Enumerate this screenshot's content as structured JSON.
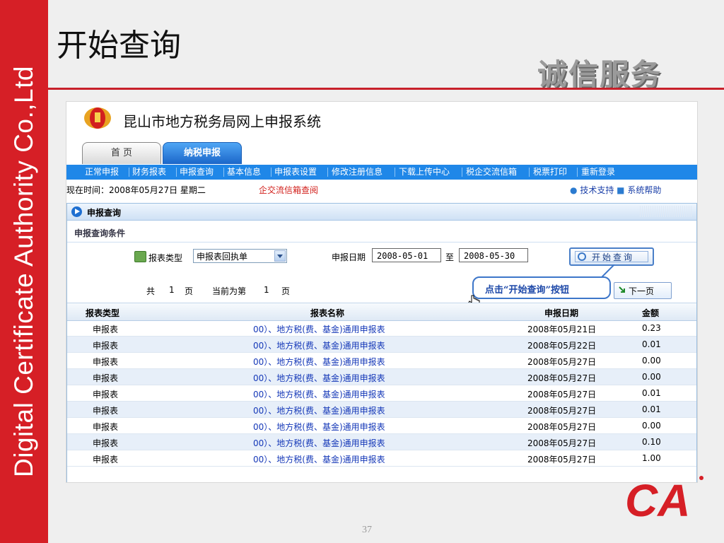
{
  "slide": {
    "sidebar_text": "Digital Certificate Authority Co.,Ltd",
    "title": "开始查询",
    "slogan": "诚信服务",
    "page_number": "37",
    "logo_text": "CA"
  },
  "app": {
    "title": "昆山市地方税务局网上申报系统",
    "tabs": [
      {
        "label": "首 页",
        "active": false
      },
      {
        "label": "纳税申报",
        "active": true
      }
    ],
    "nav": [
      "正常申报",
      "财务报表",
      "申报查询",
      "基本信息",
      "申报表设置",
      "修改注册信息",
      "下载上传中心",
      "税企交流信箱",
      "税票打印",
      "重新登录"
    ],
    "current_time": "现在时间：2008年05月27日 星期二",
    "mailbox_link": "企交流信箱查阅",
    "tech_support": "技术支持",
    "help": "系统帮助"
  },
  "panel": {
    "title": "申报查询",
    "section_label": "申报查询条件",
    "form": {
      "report_type_label": "报表类型",
      "report_type_value": "申报表回执单",
      "date_label": "申报日期",
      "date_from": "2008-05-01",
      "date_sep": "至",
      "date_to": "2008-05-30",
      "search_button": "开始查询"
    },
    "pager": {
      "total_label": "共",
      "total_pages": "1",
      "page_unit": "页",
      "current_label": "当前为第",
      "current_page": "1",
      "current_unit": "页",
      "next_button": "下一页"
    },
    "callout": "点击“开始查询”按钮",
    "table": {
      "headers": [
        "报表类型",
        "报表名称",
        "申报日期",
        "金额"
      ],
      "rows": [
        {
          "type": "申报表",
          "name": "00）、地方税(费、基金)通用申报表",
          "date": "2008年05月21日",
          "amount": "0.23"
        },
        {
          "type": "申报表",
          "name": "00）、地方税(费、基金)通用申报表",
          "date": "2008年05月22日",
          "amount": "0.01"
        },
        {
          "type": "申报表",
          "name": "00）、地方税(费、基金)通用申报表",
          "date": "2008年05月27日",
          "amount": "0.00"
        },
        {
          "type": "申报表",
          "name": "00）、地方税(费、基金)通用申报表",
          "date": "2008年05月27日",
          "amount": "0.00"
        },
        {
          "type": "申报表",
          "name": "00）、地方税(费、基金)通用申报表",
          "date": "2008年05月27日",
          "amount": "0.01"
        },
        {
          "type": "申报表",
          "name": "00）、地方税(费、基金)通用申报表",
          "date": "2008年05月27日",
          "amount": "0.01"
        },
        {
          "type": "申报表",
          "name": "00）、地方税(费、基金)通用申报表",
          "date": "2008年05月27日",
          "amount": "0.00"
        },
        {
          "type": "申报表",
          "name": "00）、地方税(费、基金)通用申报表",
          "date": "2008年05月27日",
          "amount": "0.10"
        },
        {
          "type": "申报表",
          "name": "00）、地方税(费、基金)通用申报表",
          "date": "2008年05月27日",
          "amount": "1.00"
        }
      ]
    }
  },
  "colors": {
    "brand_red": "#d61f26",
    "nav_blue": "#1f87e8",
    "link_blue": "#1538b8"
  }
}
